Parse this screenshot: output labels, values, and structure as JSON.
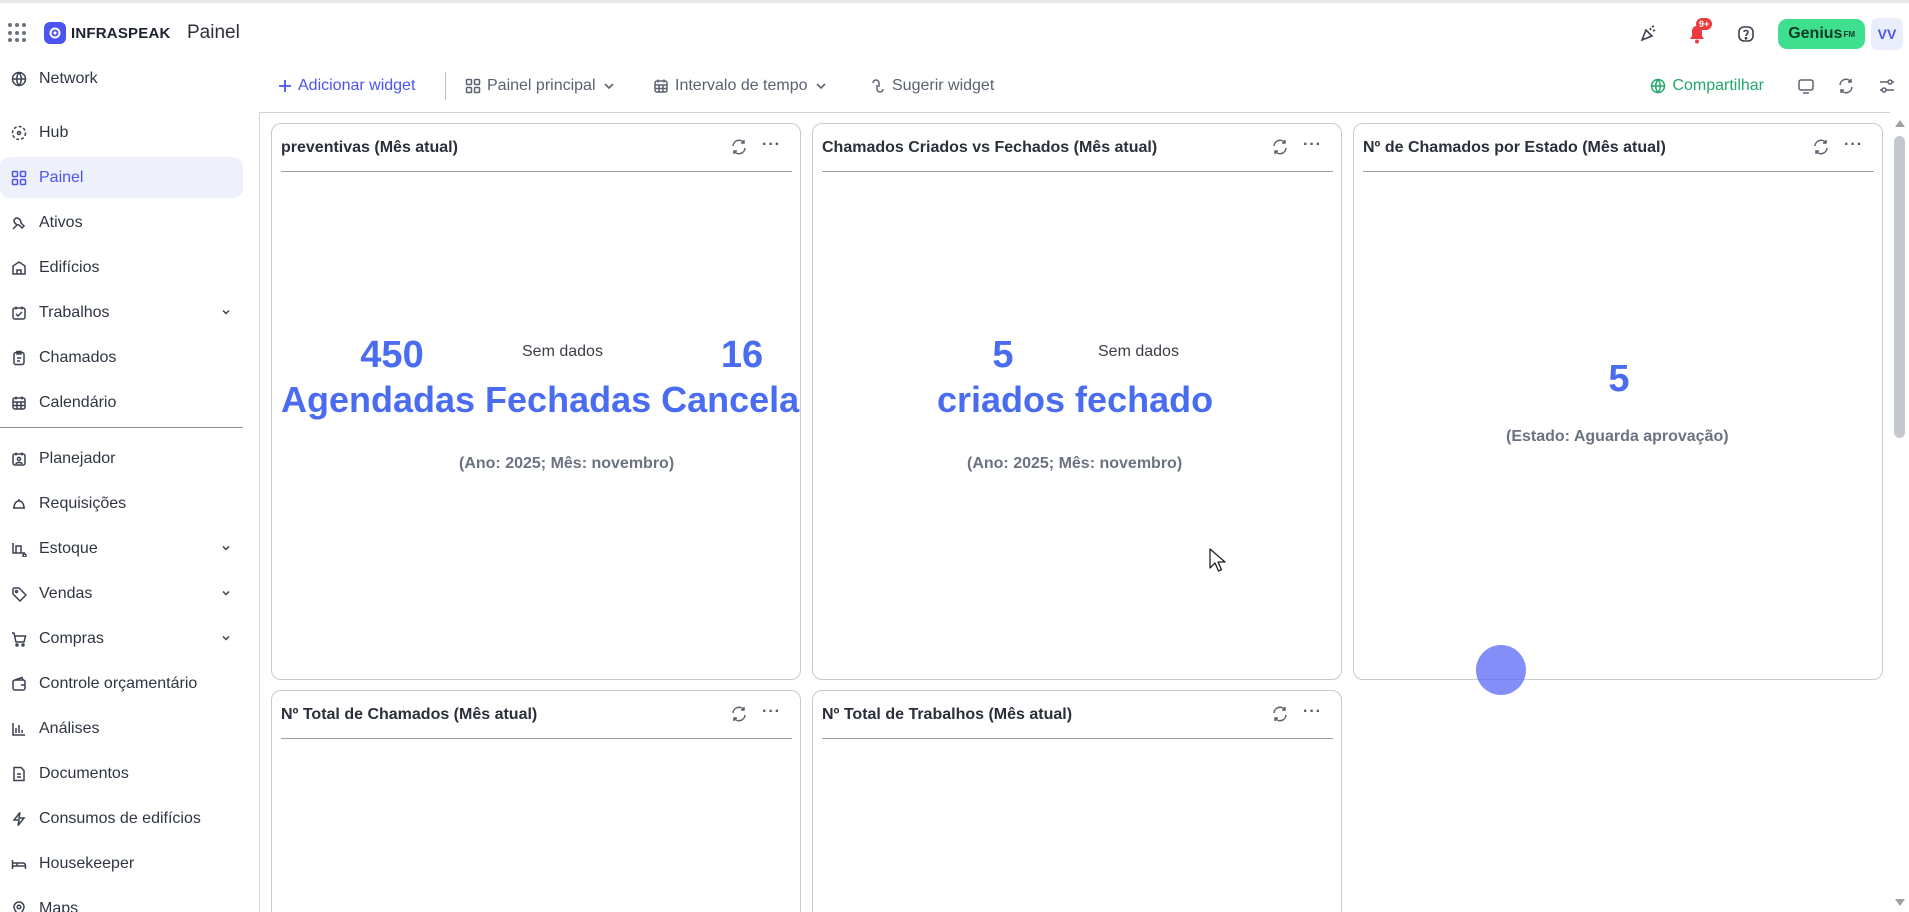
{
  "app": {
    "brand": "INFRASPEAK",
    "page_title": "Painel"
  },
  "header": {
    "notifications_badge": "9+",
    "genius_label": "Genius",
    "genius_suffix": "FM",
    "avatar_initials": "VV"
  },
  "sidebar": {
    "items": [
      {
        "label": "Network",
        "icon": "network-icon"
      },
      {
        "label": "Hub",
        "icon": "hub-icon"
      },
      {
        "label": "Painel",
        "icon": "dashboard-icon",
        "active": true
      },
      {
        "label": "Ativos",
        "icon": "assets-icon"
      },
      {
        "label": "Edifícios",
        "icon": "building-icon"
      },
      {
        "label": "Trabalhos",
        "icon": "calendar-check-icon",
        "expandable": true
      },
      {
        "label": "Chamados",
        "icon": "clipboard-icon"
      },
      {
        "label": "Calendário",
        "icon": "calendar-icon"
      },
      {
        "label": "Planejador",
        "icon": "planner-icon"
      },
      {
        "label": "Requisições",
        "icon": "bell-service-icon"
      },
      {
        "label": "Estoque",
        "icon": "stock-icon",
        "expandable": true
      },
      {
        "label": "Vendas",
        "icon": "tag-icon",
        "expandable": true
      },
      {
        "label": "Compras",
        "icon": "cart-icon",
        "expandable": true
      },
      {
        "label": "Controle orçamentário",
        "icon": "wallet-icon"
      },
      {
        "label": "Análises",
        "icon": "bar-chart-icon"
      },
      {
        "label": "Documentos",
        "icon": "document-icon"
      },
      {
        "label": "Consumos de edifícios",
        "icon": "lightning-icon"
      },
      {
        "label": "Housekeeper",
        "icon": "bed-icon"
      },
      {
        "label": "Maps",
        "icon": "map-pin-icon"
      }
    ]
  },
  "toolbar": {
    "add_widget": "Adicionar widget",
    "dashboard_select": "Painel principal",
    "time_interval": "Intervalo de tempo",
    "suggest_widget": "Sugerir widget",
    "share": "Compartilhar"
  },
  "widgets": {
    "preventivas": {
      "title": "preventivas (Mês atual)",
      "value_left": "450",
      "no_data": "Sem dados",
      "value_right": "16",
      "labels": "Agendadas Fechadas Cancelad",
      "note": "(Ano: 2025; Mês: novembro)"
    },
    "chamados_cf": {
      "title": "Chamados Criados vs Fechados (Mês atual)",
      "value_left": "5",
      "no_data": "Sem dados",
      "labels": "criados fechado",
      "note": "(Ano: 2025; Mês: novembro)"
    },
    "chamados_estado": {
      "title": "Nº de Chamados por Estado (Mês atual)",
      "value": "5",
      "note": "(Estado: Aguarda aprovação)"
    },
    "total_chamados": {
      "title": "Nº Total de Chamados (Mês atual)"
    },
    "total_trabalhos": {
      "title": "Nº Total de Trabalhos (Mês atual)"
    }
  },
  "colors": {
    "accent": "#4a54f1",
    "kpi": "#4a6cf0",
    "share_green": "#22a86a",
    "genius_green": "#3ee08f",
    "notification_red": "#ef3b3b"
  }
}
